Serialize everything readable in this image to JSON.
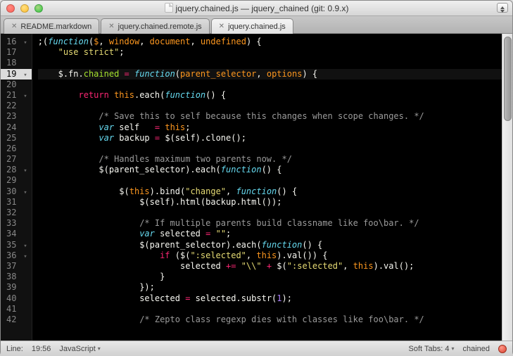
{
  "window": {
    "title": "jquery.chained.js — jquery_chained (git: 0.9.x)"
  },
  "tabs": [
    {
      "label": "README.markdown"
    },
    {
      "label": "jquery.chained.remote.js"
    },
    {
      "label": "jquery.chained.js"
    }
  ],
  "gutter": [
    {
      "n": "16",
      "f": "▾"
    },
    {
      "n": "17"
    },
    {
      "n": "18"
    },
    {
      "n": "19",
      "f": "▾",
      "hl": true
    },
    {
      "n": "20"
    },
    {
      "n": "21",
      "f": "▾"
    },
    {
      "n": "22"
    },
    {
      "n": "23"
    },
    {
      "n": "24"
    },
    {
      "n": "25"
    },
    {
      "n": "26"
    },
    {
      "n": "27"
    },
    {
      "n": "28",
      "f": "▾"
    },
    {
      "n": "29"
    },
    {
      "n": "30",
      "f": "▾"
    },
    {
      "n": "31"
    },
    {
      "n": "32"
    },
    {
      "n": "33"
    },
    {
      "n": "34"
    },
    {
      "n": "35",
      "f": "▾"
    },
    {
      "n": "36",
      "f": "▾"
    },
    {
      "n": "37"
    },
    {
      "n": "38"
    },
    {
      "n": "39"
    },
    {
      "n": "40"
    },
    {
      "n": "41"
    },
    {
      "n": "42"
    }
  ],
  "code": {
    "l16": ";(function($, window, document, undefined) {",
    "l17": "\"use strict\"",
    "l19": "$.fn.chained = function(parent_selector, options) {",
    "l21": "return this.each(function() {",
    "l23": "/* Save this to self because this changes when scope changes. */",
    "l24a": "var",
    "l24b": "self",
    "l24c": "= ",
    "l24d": "this",
    "l25a": "var",
    "l25b": "backup = $(self).clone();",
    "l27": "/* Handles maximum two parents now. */",
    "l28": "$(parent_selector).each(function() {",
    "l30a": "$(",
    "l30b": "this",
    "l30c": ").bind(",
    "l30d": "\"change\"",
    "l30e": ", ",
    "l30f": "function",
    "l30g": "() {",
    "l31a": "$(self).html(backup.html());",
    "l33": "/* If multiple parents build classname like foo\\bar. */",
    "l34a": "var",
    "l34b": "selected = ",
    "l34c": "\"\"",
    "l35a": "$(parent_selector).each(",
    "l35b": "function",
    "l35c": "() {",
    "l36a": "if",
    "l36b": " ($(",
    "l36c": "\":selected\"",
    "l36d": ", ",
    "l36e": "this",
    "l36f": ").val()) {",
    "l37a": "selected ",
    "l37b": "+=",
    "l37c": " ",
    "l37d": "\"\\\\\"",
    "l37e": " + $(",
    "l37f": "\":selected\"",
    "l37g": ", ",
    "l37h": "this",
    "l37i": ").val();",
    "l38": "}",
    "l39": "});",
    "l40a": "selected = selected.substr(",
    "l40b": "1",
    "l40c": ");",
    "l42": "/* Zepto class regexp dies with classes like foo\\bar. */"
  },
  "status": {
    "line_label": "Line:",
    "position": "19:56",
    "language": "JavaScript",
    "indent": "Soft Tabs: 4",
    "branch": "chained"
  }
}
